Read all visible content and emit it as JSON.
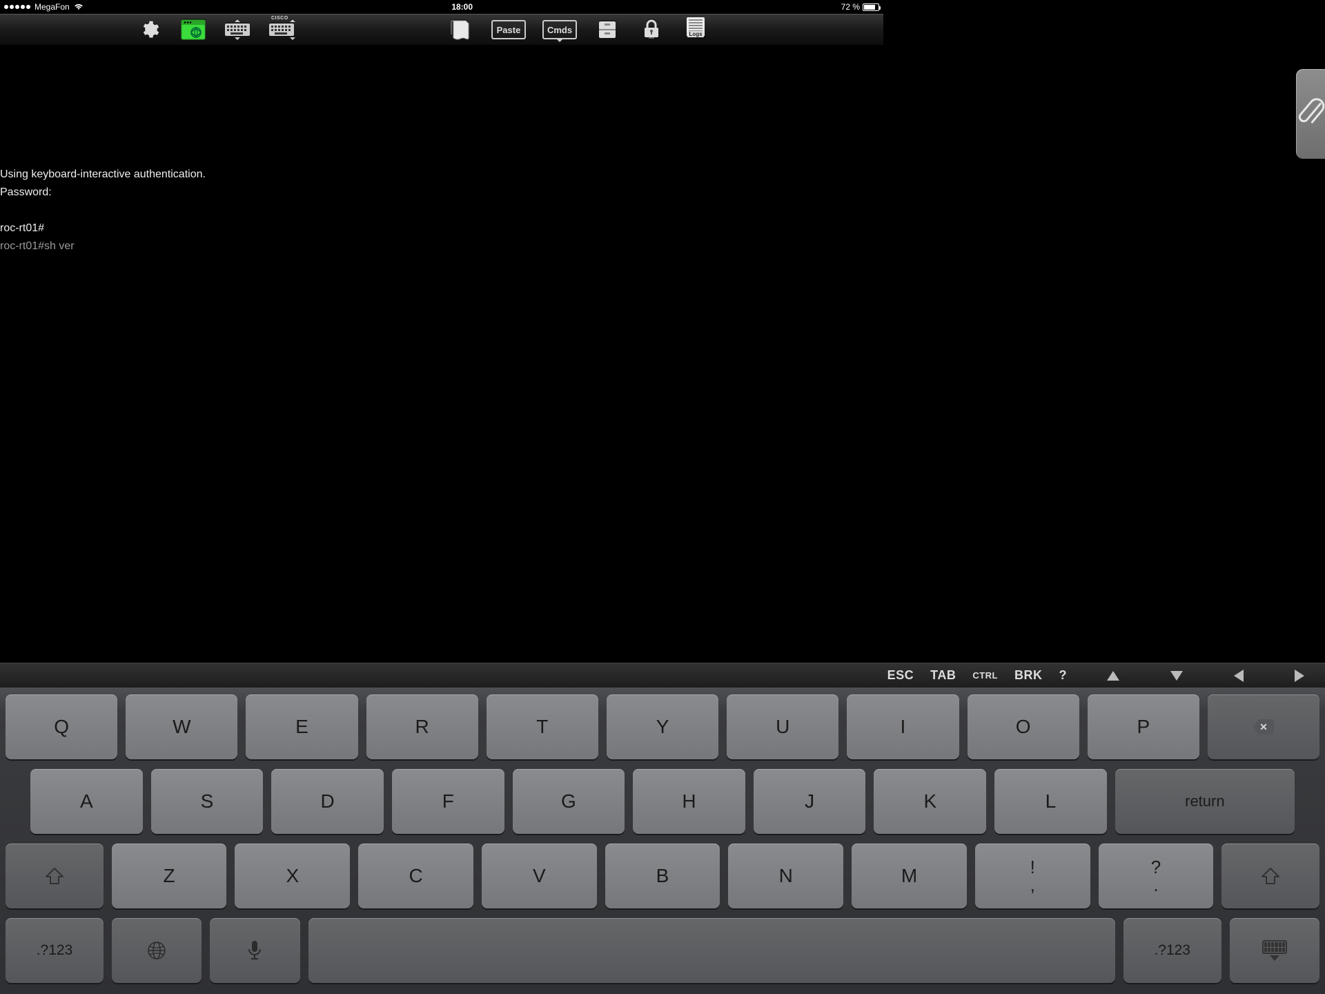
{
  "status": {
    "carrier": "MegaFon",
    "time": "18:00",
    "battery_text": "72 %"
  },
  "toolbar": {
    "paste_label": "Paste",
    "cmds_label": "Cmds",
    "logs_label": "Logs",
    "cisco_label": "CISCO"
  },
  "aux_keys": {
    "esc": "ESC",
    "tab": "TAB",
    "ctrl": "CTRL",
    "brk": "BRK",
    "q": "?"
  },
  "terminal": {
    "lines": [
      "Using keyboard-interactive authentication.",
      "Password:",
      "",
      "roc-rt01#",
      "roc-rt01#sh ver"
    ],
    "dim_last": true
  },
  "keyboard": {
    "row1": [
      "Q",
      "W",
      "E",
      "R",
      "T",
      "Y",
      "U",
      "I",
      "O",
      "P"
    ],
    "row2": [
      "A",
      "S",
      "D",
      "F",
      "G",
      "H",
      "J",
      "K",
      "L"
    ],
    "row3": [
      "Z",
      "X",
      "C",
      "V",
      "B",
      "N",
      "M"
    ],
    "punct1_top": "!",
    "punct1_bot": ",",
    "punct2_top": "?",
    "punct2_bot": ".",
    "return_label": "return",
    "mode_label": ".?123"
  }
}
